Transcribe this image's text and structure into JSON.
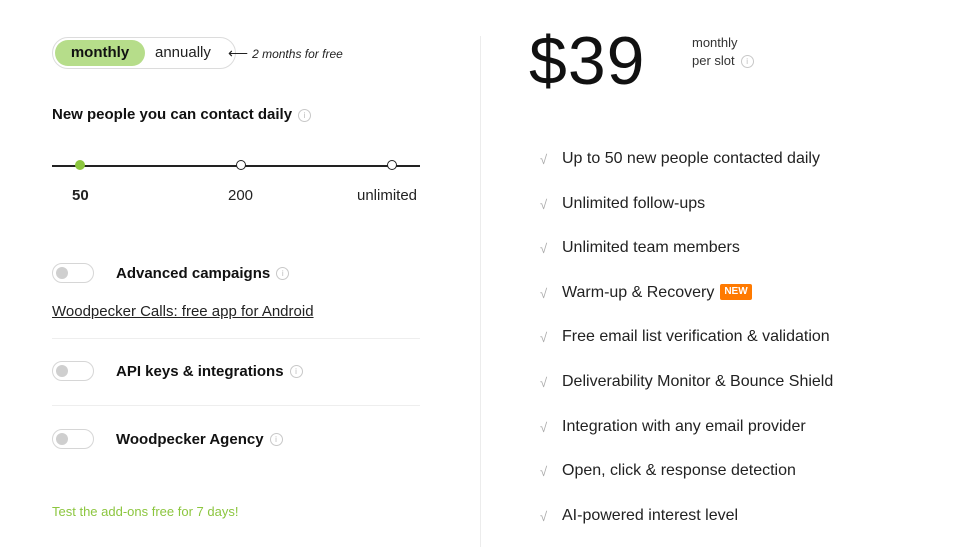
{
  "billing": {
    "monthly_label": "monthly",
    "annually_label": "annually",
    "promo_text": "2 months for free"
  },
  "contacts": {
    "heading": "New people you can contact daily",
    "stops": [
      "50",
      "200",
      "unlimited"
    ],
    "selected": "50"
  },
  "addons": {
    "advanced": "Advanced campaigns",
    "android_link": "Woodpecker Calls: free app for Android",
    "api": "API keys & integrations",
    "agency": "Woodpecker Agency",
    "trial": "Test the add-ons free for 7 days!"
  },
  "pricing": {
    "price": "$39",
    "line1": "monthly",
    "line2": "per slot"
  },
  "features": [
    "Up to 50 new people contacted daily",
    "Unlimited follow-ups",
    "Unlimited team members",
    "Warm-up & Recovery",
    "Free email list verification & validation",
    "Deliverability Monitor & Bounce Shield",
    "Integration with any email provider",
    "Open, click & response detection",
    "AI-powered interest level"
  ],
  "new_badge": "NEW",
  "colors": {
    "accent_green": "#8cc63f",
    "toggle_green": "#b6dd8a",
    "badge_orange": "#ff7a00"
  }
}
